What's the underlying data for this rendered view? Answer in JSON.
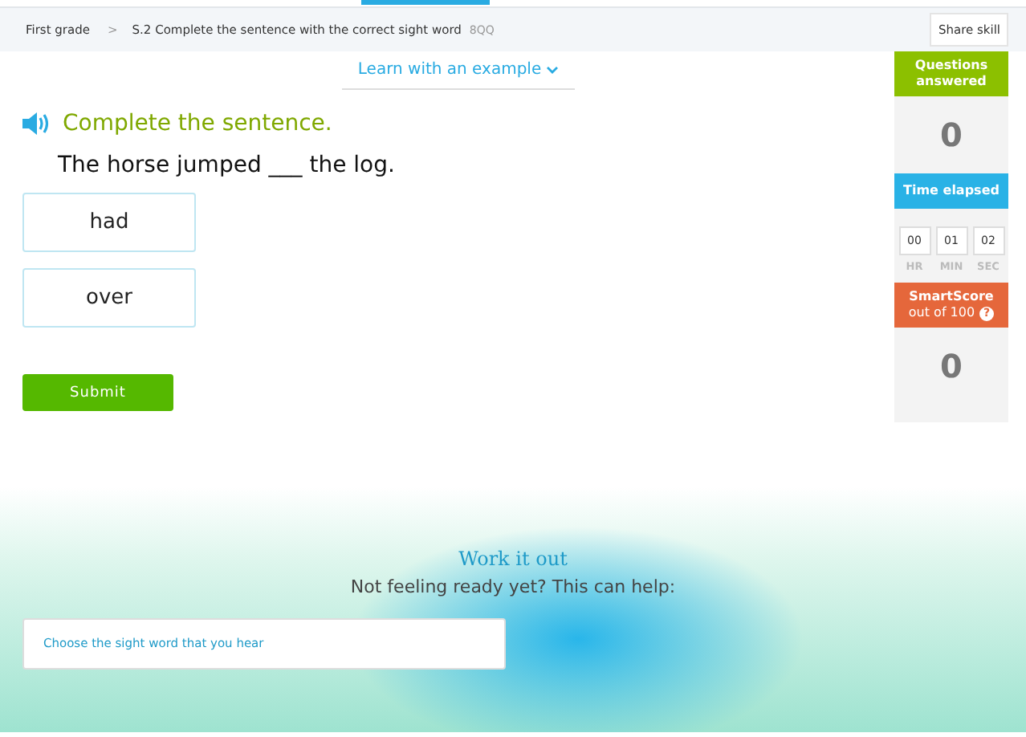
{
  "breadcrumb": {
    "grade": "First grade",
    "separator": ">",
    "skill": "S.2 Complete the sentence with the correct sight word",
    "code": "8QQ"
  },
  "share_button": "Share skill",
  "learn_link": "Learn with an example",
  "prompt": "Complete the sentence.",
  "sentence": "The horse jumped ___ the log.",
  "choices": [
    {
      "label": "had",
      "selected": false
    },
    {
      "label": "over",
      "selected": false
    }
  ],
  "submit_button": "Submit",
  "stats": {
    "questions_label": "Questions answered",
    "questions_value": "0",
    "time_label": "Time elapsed",
    "time": [
      {
        "value": "00",
        "unit": "HR"
      },
      {
        "value": "01",
        "unit": "MIN"
      },
      {
        "value": "02",
        "unit": "SEC"
      }
    ],
    "score_label": "SmartScore",
    "score_sub": "out of 100",
    "score_help": "?",
    "score_value": "0"
  },
  "work_it_out": {
    "title": "Work it out",
    "subtitle": "Not feeling ready yet? This can help:",
    "links": [
      "Choose the sight word that you hear"
    ]
  }
}
